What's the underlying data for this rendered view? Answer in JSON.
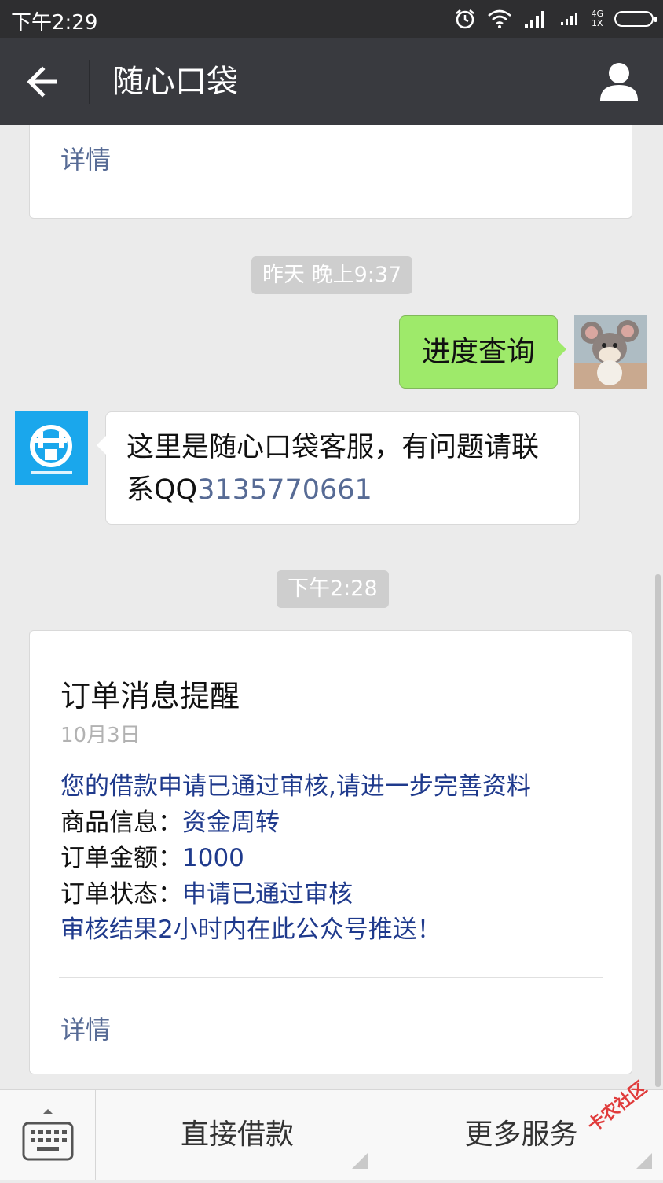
{
  "status_bar": {
    "time": "下午2:29",
    "network_type": "4G",
    "sim_label": "1X"
  },
  "header": {
    "title": "随心口袋"
  },
  "chat": {
    "top_card_link": "详情",
    "timestamp_1": "昨天 晚上9:37",
    "outgoing_message": "进度查询",
    "incoming_message_text": "这里是随心口袋客服，有问题请联系QQ",
    "incoming_message_link": "3135770661",
    "timestamp_2": "下午2:28",
    "order_card": {
      "title": "订单消息提醒",
      "date": "10月3日",
      "intro": "您的借款申请已通过审核,请进一步完善资料",
      "product_label": "商品信息：",
      "product_value": "资金周转",
      "amount_label": "订单金额：",
      "amount_value": "1000",
      "status_label": "订单状态：",
      "status_value": "申请已通过审核",
      "notice": "审核结果2小时内在此公众号推送！",
      "link": "详情"
    }
  },
  "bottom_menu": {
    "item_1": "直接借款",
    "item_2": "更多服务"
  },
  "watermark": "卡农社区",
  "colors": {
    "accent_link": "#576b95",
    "order_text": "#1f3a8c",
    "outgoing_bubble": "#9eea6a",
    "header_bg": "#393a3f",
    "bot_avatar": "#1aa7ec"
  }
}
